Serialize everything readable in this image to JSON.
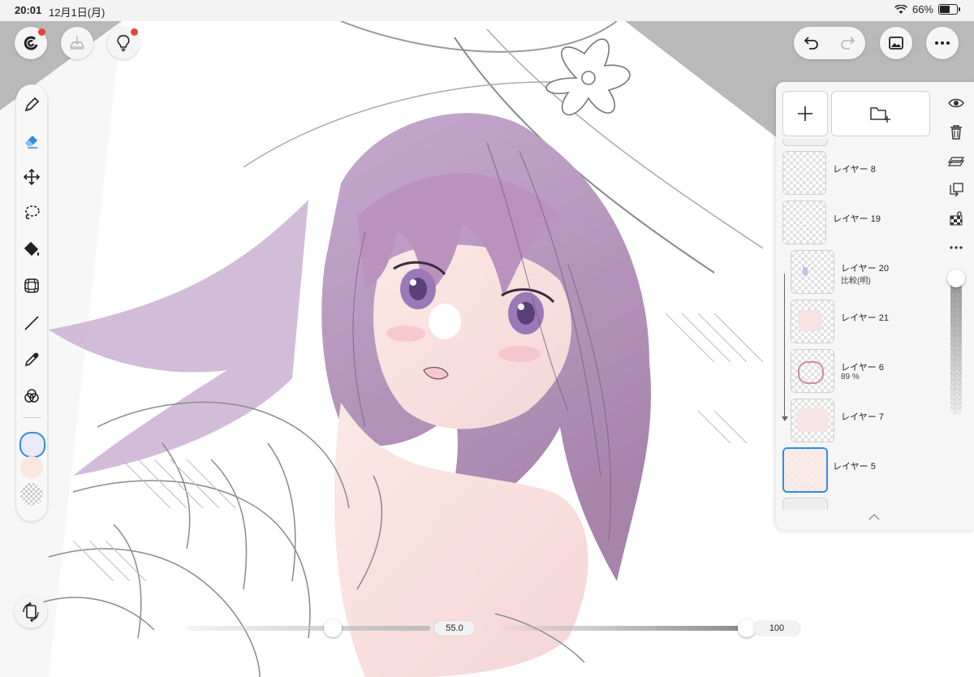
{
  "status_bar": {
    "time": "20:01",
    "date": "12月1日(月)",
    "battery": "66%",
    "battery_fraction": 0.66
  },
  "top_left_buttons": [
    {
      "name": "app-logo-icon",
      "has_badge": true
    },
    {
      "name": "clip-tray-icon",
      "has_badge": false
    },
    {
      "name": "lightbulb-icon",
      "has_badge": true
    }
  ],
  "top_right_buttons": [
    "undo-icon",
    "redo-icon",
    "gallery-icon",
    "more-icon"
  ],
  "tools": [
    "pen-icon",
    "eraser-icon",
    "move-icon",
    "lasso-icon",
    "fill-icon",
    "transform-grid-icon",
    "line-icon",
    "eyedropper-icon",
    "color-mix-icon"
  ],
  "active_tool": "eraser-icon",
  "colors": {
    "primary": "#eceaf8",
    "secondary": "#fbe6e0",
    "accent": "#2d8ce6"
  },
  "layers_panel": {
    "layers": [
      {
        "name": "レイヤー 8",
        "sub": "",
        "selected": false,
        "clipped": false
      },
      {
        "name": "レイヤー 19",
        "sub": "",
        "selected": false,
        "clipped": false
      },
      {
        "name": "レイヤー 20",
        "sub": "比較(明)",
        "selected": false,
        "clipped": true
      },
      {
        "name": "レイヤー 21",
        "sub": "",
        "selected": false,
        "clipped": true
      },
      {
        "name": "レイヤー 6",
        "sub": "89 %",
        "selected": false,
        "clipped": true
      },
      {
        "name": "レイヤー 7",
        "sub": "",
        "selected": false,
        "clipped": true
      },
      {
        "name": "レイヤー 5",
        "sub": "",
        "selected": true,
        "clipped": false
      }
    ],
    "side_icons": [
      "eye-icon",
      "trash-icon",
      "merge-layers-icon",
      "clip-layer-icon",
      "alpha-lock-icon",
      "more-dots-icon"
    ],
    "layer_opacity_fraction": 1.0
  },
  "bottom_sliders": {
    "brush_size": {
      "value": "55.0",
      "fraction": 0.6
    },
    "opacity": {
      "value": "100",
      "fraction": 1.0
    }
  }
}
